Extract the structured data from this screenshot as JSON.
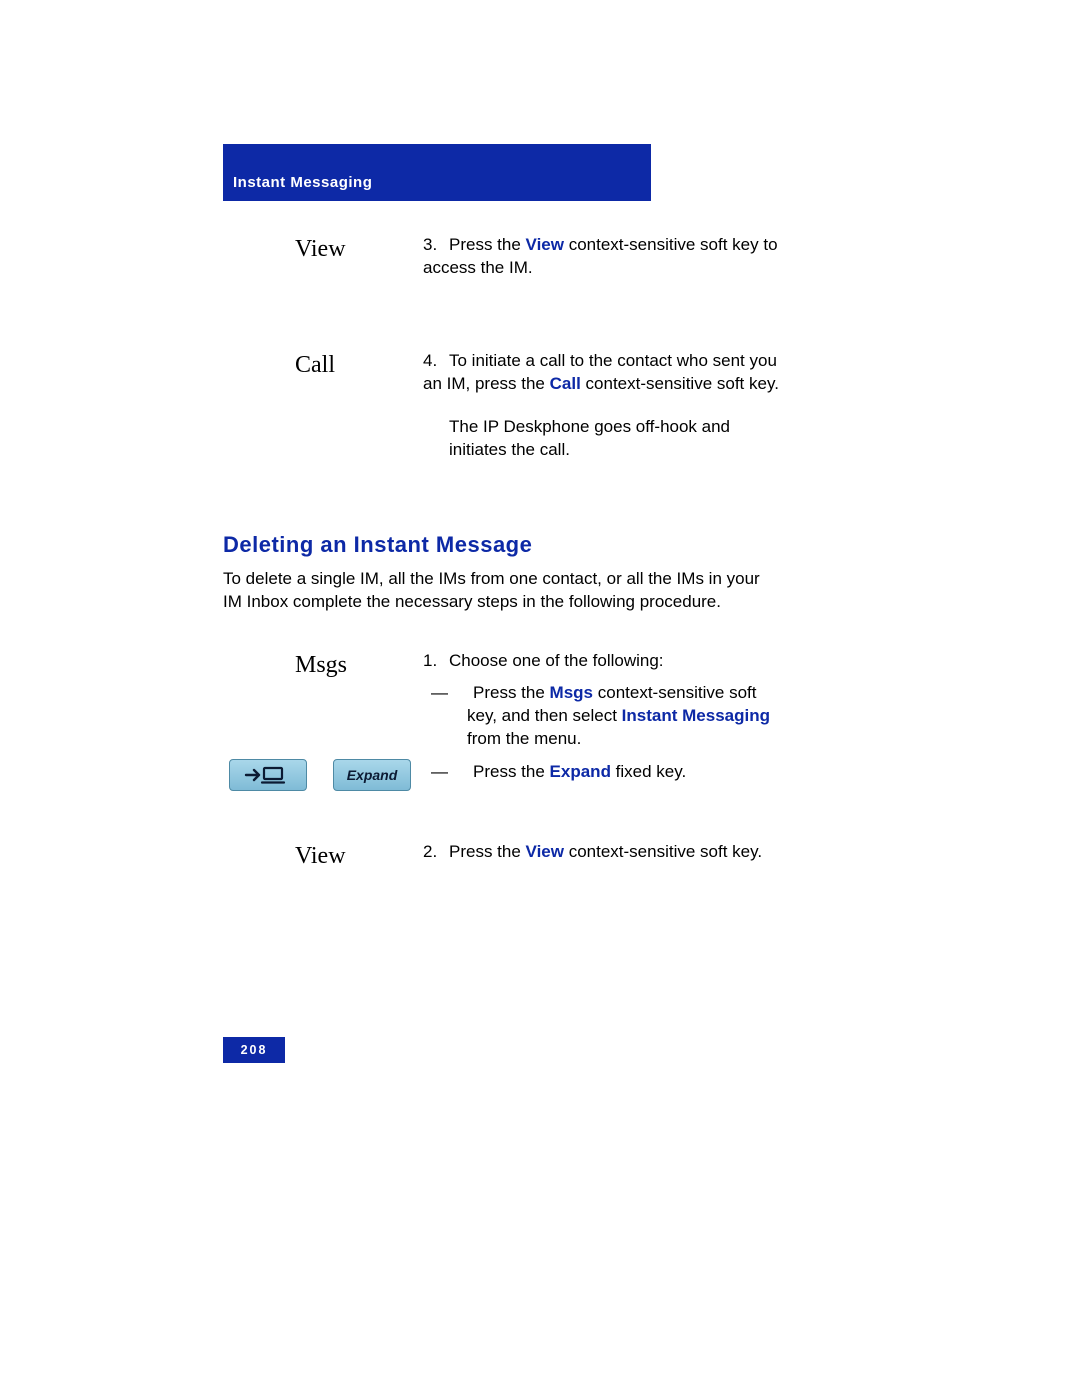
{
  "header": {
    "title": "Instant Messaging"
  },
  "steps_top": {
    "view": {
      "key_label": "View",
      "num": "3.",
      "text_pre": "Press the ",
      "text_bold": "View",
      "text_post": " context-sensitive soft key to access the IM."
    },
    "call": {
      "key_label": "Call",
      "num": "4.",
      "text_pre": "To initiate a call to the contact who sent you an IM, press the ",
      "text_bold": "Call",
      "text_post": " context-sensitive soft key.",
      "para2": "The IP Deskphone goes off-hook and initiates the call."
    }
  },
  "section": {
    "heading": "Deleting an Instant Message",
    "intro": "To delete a single IM, all the IMs from one contact, or all the IMs in your IM Inbox complete the necessary steps in the following procedure."
  },
  "steps_bottom": {
    "msgs": {
      "key_label": "Msgs",
      "num": "1.",
      "lead": "Choose one of the following:",
      "bullet1_pre": "Press the ",
      "bullet1_b1": "Msgs",
      "bullet1_mid": " context-sensitive soft key, and then select ",
      "bullet1_b2": "Instant Messaging",
      "bullet1_post": " from the menu.",
      "bullet2_pre": "Press the ",
      "bullet2_b1": "Expand",
      "bullet2_post": " fixed key.",
      "expand_btn_label": "Expand"
    },
    "view": {
      "key_label": "View",
      "num": "2.",
      "text_pre": "Press the ",
      "text_bold": "View",
      "text_post": " context-sensitive soft key."
    }
  },
  "footer": {
    "page_number": "208"
  }
}
